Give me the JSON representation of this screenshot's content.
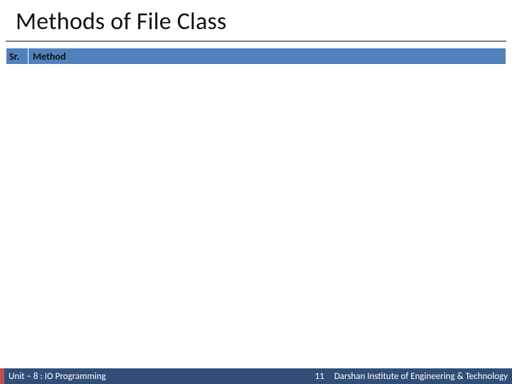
{
  "title": "Methods of File Class",
  "table": {
    "headers": {
      "sr": "Sr.",
      "method": "Method"
    }
  },
  "footer": {
    "left": "Unit – 8 : IO Programming",
    "page": "11",
    "right": "Darshan Institute of Engineering & Technology"
  }
}
